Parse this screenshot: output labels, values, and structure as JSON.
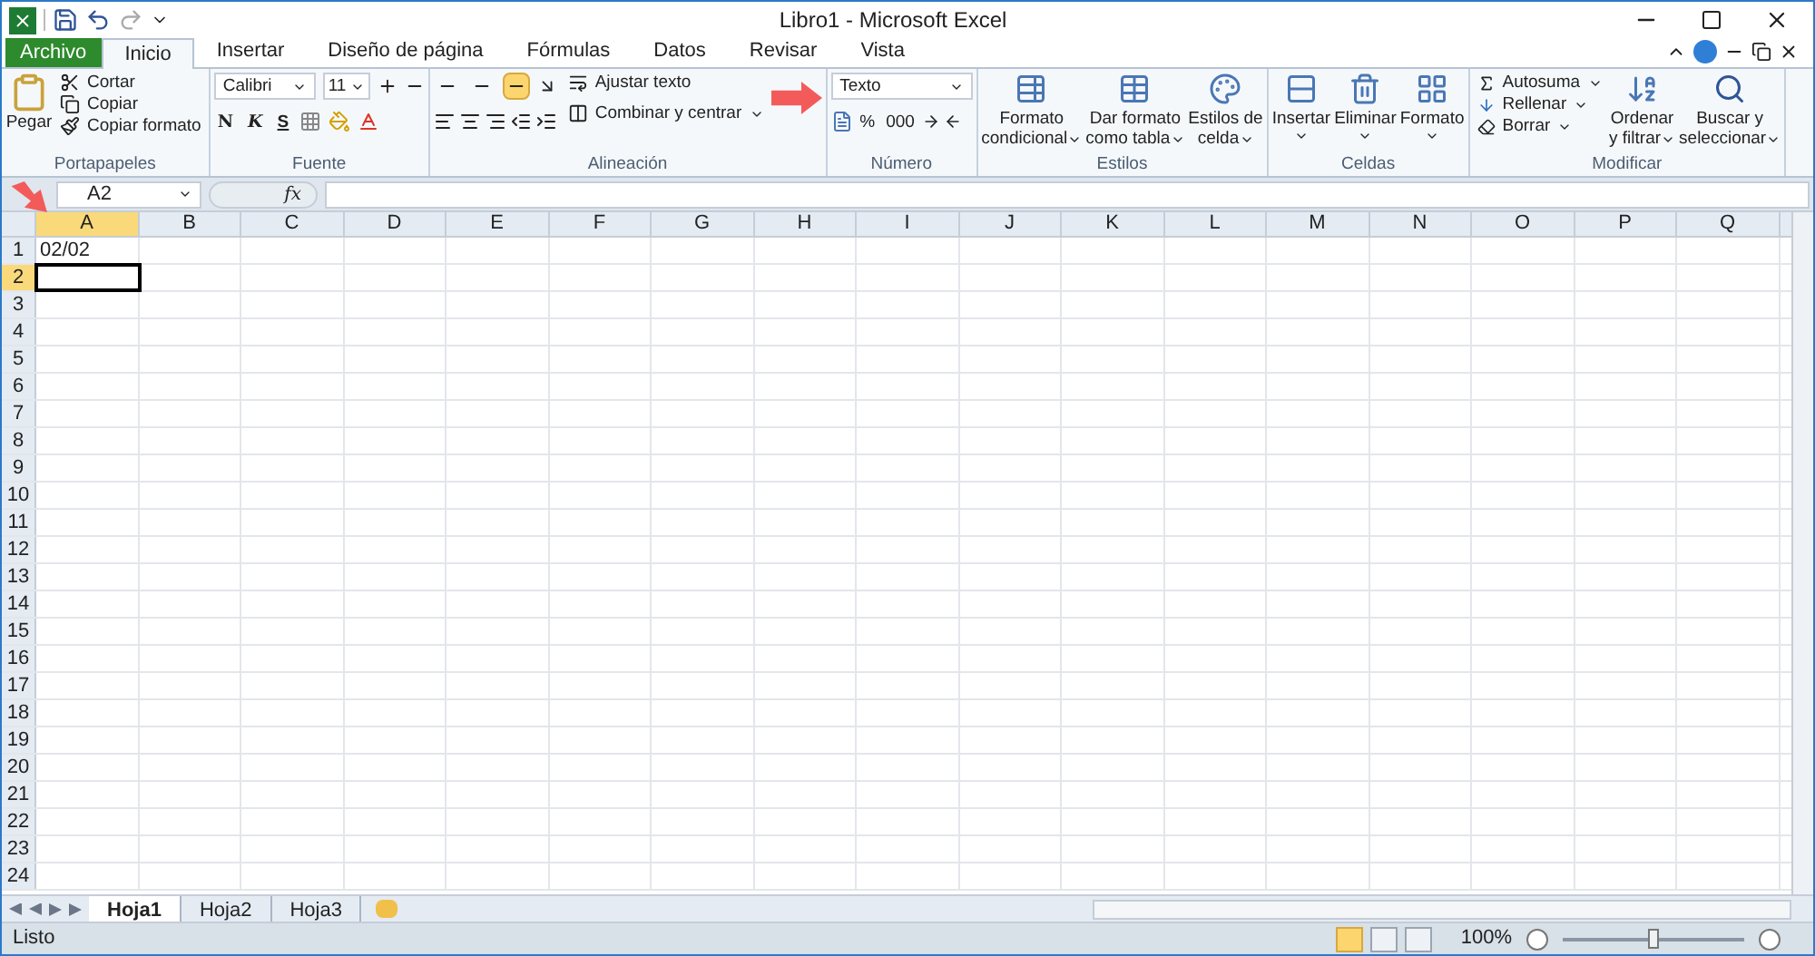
{
  "window": {
    "title": "Libro1  -  Microsoft Excel"
  },
  "file_tab": "Archivo",
  "tabs": [
    {
      "label": "Inicio",
      "selected": true
    },
    {
      "label": "Insertar",
      "selected": false
    },
    {
      "label": "Diseño de página",
      "selected": false
    },
    {
      "label": "Fórmulas",
      "selected": false
    },
    {
      "label": "Datos",
      "selected": false
    },
    {
      "label": "Revisar",
      "selected": false
    },
    {
      "label": "Vista",
      "selected": false
    }
  ],
  "ribbon": {
    "clipboard": {
      "paste": "Pegar",
      "cut": "Cortar",
      "copy": "Copiar",
      "format_painter": "Copiar formato",
      "label": "Portapapeles"
    },
    "font": {
      "name": "Calibri",
      "size": "11",
      "bold": "N",
      "italic": "K",
      "strike": "S",
      "label": "Fuente"
    },
    "alignment": {
      "vertical": [
        {
          "selected": false
        },
        {
          "selected": false
        },
        {
          "selected": true
        }
      ],
      "wrap": "Ajustar texto",
      "merge": "Combinar y centrar",
      "label": "Alineación"
    },
    "number": {
      "format": "Texto",
      "percent": "%",
      "thousands": "000",
      "label": "Número"
    },
    "styles": {
      "buttons": [
        {
          "lines": [
            "Formato",
            "condicional"
          ]
        },
        {
          "lines": [
            "Dar formato",
            "como tabla"
          ]
        },
        {
          "lines": [
            "Estilos de",
            "celda"
          ]
        }
      ],
      "label": "Estilos"
    },
    "cells": {
      "buttons": [
        {
          "label": "Insertar"
        },
        {
          "label": "Eliminar"
        },
        {
          "label": "Formato"
        }
      ],
      "label": "Celdas"
    },
    "editing": {
      "autosum": "Autosuma",
      "fill": "Rellenar",
      "clear": "Borrar",
      "sort": [
        "Ordenar",
        "y filtrar"
      ],
      "find": [
        "Buscar y",
        "seleccionar"
      ],
      "label": "Modificar"
    }
  },
  "formula_bar": {
    "name_box": "A2",
    "function_label": "fx"
  },
  "grid": {
    "columns": [
      {
        "label": "A",
        "selected": true
      },
      {
        "label": "B",
        "selected": false
      },
      {
        "label": "C",
        "selected": false
      },
      {
        "label": "D",
        "selected": false
      },
      {
        "label": "E",
        "selected": false
      },
      {
        "label": "F",
        "selected": false
      },
      {
        "label": "G",
        "selected": false
      },
      {
        "label": "H",
        "selected": false
      },
      {
        "label": "I",
        "selected": false
      },
      {
        "label": "J",
        "selected": false
      },
      {
        "label": "K",
        "selected": false
      },
      {
        "label": "L",
        "selected": false
      },
      {
        "label": "M",
        "selected": false
      },
      {
        "label": "N",
        "selected": false
      },
      {
        "label": "O",
        "selected": false
      },
      {
        "label": "P",
        "selected": false
      },
      {
        "label": "Q",
        "selected": false
      }
    ],
    "rows": [
      {
        "label": "1",
        "selected": false,
        "cells": [
          "02/02"
        ]
      },
      {
        "label": "2",
        "selected": true
      },
      {
        "label": "3",
        "selected": false
      },
      {
        "label": "4",
        "selected": false
      },
      {
        "label": "5",
        "selected": false
      },
      {
        "label": "6",
        "selected": false
      },
      {
        "label": "7",
        "selected": false
      },
      {
        "label": "8",
        "selected": false
      },
      {
        "label": "9",
        "selected": false
      },
      {
        "label": "10",
        "selected": false
      },
      {
        "label": "11",
        "selected": false
      },
      {
        "label": "12",
        "selected": false
      },
      {
        "label": "13",
        "selected": false
      },
      {
        "label": "14",
        "selected": false
      },
      {
        "label": "15",
        "selected": false
      },
      {
        "label": "16",
        "selected": false
      },
      {
        "label": "17",
        "selected": false
      },
      {
        "label": "18",
        "selected": false
      },
      {
        "label": "19",
        "selected": false
      },
      {
        "label": "20",
        "selected": false
      },
      {
        "label": "21",
        "selected": false
      },
      {
        "label": "22",
        "selected": false
      },
      {
        "label": "23",
        "selected": false
      },
      {
        "label": "24",
        "selected": false
      }
    ]
  },
  "sheet_tabs": [
    {
      "label": "Hoja1",
      "selected": true
    },
    {
      "label": "Hoja2",
      "selected": false
    },
    {
      "label": "Hoja3",
      "selected": false
    }
  ],
  "status_bar": {
    "status": "Listo",
    "view_buttons": [
      {
        "selected": true
      },
      {
        "selected": false
      },
      {
        "selected": false
      }
    ],
    "zoom": "100%",
    "zoom_level": {
      "level": 0.5
    }
  }
}
